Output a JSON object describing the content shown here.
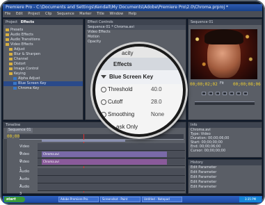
{
  "window": {
    "title": "Premiere Pro - C:\\Documents and Settings\\Kendall\\My Documents\\Adobe\\Premiere Pro\\2.0\\Chroma.prproj *"
  },
  "menu": {
    "items": [
      "File",
      "Edit",
      "Project",
      "Clip",
      "Sequence",
      "Marker",
      "Title",
      "Window",
      "Help"
    ]
  },
  "project_panel": {
    "tabs": [
      "Project",
      "Effects"
    ],
    "items": [
      {
        "icon": "folder-icon",
        "label": "Presets"
      },
      {
        "icon": "folder-icon",
        "label": "Audio Effects"
      },
      {
        "icon": "folder-icon",
        "label": "Audio Transitions"
      },
      {
        "icon": "folder-icon",
        "label": "Video Effects"
      },
      {
        "icon": "folder-icon",
        "label": "Adjust"
      },
      {
        "icon": "folder-icon",
        "label": "Blur & Sharpen"
      },
      {
        "icon": "folder-icon",
        "label": "Channel"
      },
      {
        "icon": "folder-icon",
        "label": "Distort"
      },
      {
        "icon": "folder-icon",
        "label": "Image Control"
      },
      {
        "icon": "folder-icon",
        "label": "Keying"
      },
      {
        "icon": "effect-icon",
        "label": "Alpha Adjust"
      },
      {
        "icon": "effect-icon",
        "label": "Blue Screen Key"
      },
      {
        "icon": "effect-icon",
        "label": "Chroma Key"
      }
    ]
  },
  "effect_controls": {
    "tab": "Effect Controls",
    "rows": [
      "Sequence 01 * Chroma.avi",
      "Video Effects",
      "Motion",
      "Opacity"
    ]
  },
  "magnifier": {
    "partial_top": "acity",
    "section": "Effects",
    "effect_name": "Blue Screen Key",
    "params": [
      {
        "label": "Threshold",
        "value": "40.0"
      },
      {
        "label": "Cutoff",
        "value": "28.0"
      },
      {
        "label": "Smoothing",
        "value": "None"
      }
    ],
    "partial_bottom": "ask Only"
  },
  "program_monitor": {
    "tab": "Sequence 01",
    "timecode_left": "00;00;02;02",
    "timecode_right": "00;00;08;06",
    "fit_label": "Fit"
  },
  "timeline": {
    "tab": "Timeline",
    "sequence_tab": "Sequence 01",
    "timecode": "00;00;02;02",
    "tracks": [
      {
        "label": "Video 3",
        "clip": ""
      },
      {
        "label": "Video 2",
        "clip": "Chroma.avi"
      },
      {
        "label": "Video 1",
        "clip": "Chroma.avi"
      },
      {
        "label": "Audio 1",
        "clip": ""
      },
      {
        "label": "Audio 2",
        "clip": ""
      },
      {
        "label": "Audio 3",
        "clip": ""
      }
    ]
  },
  "info_panel": {
    "tab": "Info",
    "lines": [
      "Chroma.avi",
      "Type: Video",
      "Duration: 00;00;06;00",
      "Start: 00;00;00;00",
      "End: 00;00;06;00",
      "Cursor: 00;00;00;00"
    ]
  },
  "history_panel": {
    "tab": "History",
    "items": [
      "Edit Parameter",
      "Edit Parameter",
      "Edit Parameter",
      "Edit Parameter",
      "Edit Parameter"
    ]
  },
  "taskbar": {
    "start_label": "start",
    "tasks": [
      "Adobe Premiere Pro",
      "Screenshot - Paint",
      "Untitled - Notepad"
    ],
    "clock": "3:35 PM"
  }
}
